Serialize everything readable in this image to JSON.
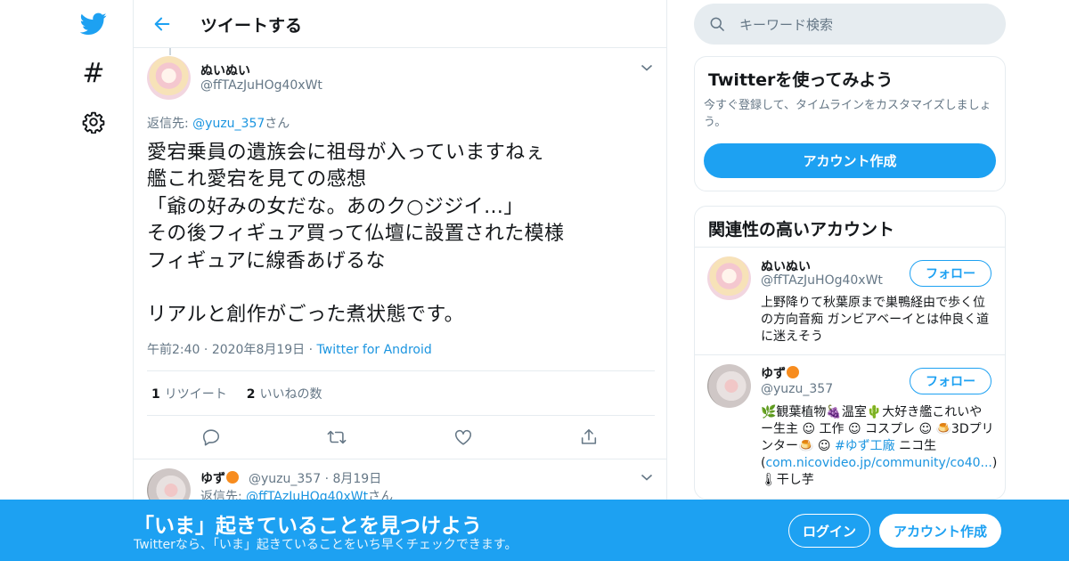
{
  "colors": {
    "accent": "#1da1f2",
    "link": "#1b95e0",
    "muted": "#657786",
    "border": "#e6ecf0"
  },
  "nav": {
    "items": [
      {
        "icon": "twitter-bird-icon"
      },
      {
        "icon": "hashtag-icon",
        "glyph": "#"
      },
      {
        "icon": "gear-icon"
      }
    ]
  },
  "header": {
    "title": "ツイートする",
    "back_icon": "back-arrow-icon"
  },
  "tweet": {
    "name": "ぬいぬい",
    "handle": "@ffTAzJuHOg40xWt",
    "reply_prefix": "返信先: ",
    "reply_to": "@yuzu_357",
    "reply_suffix": "さん",
    "body": "愛宕乗員の遺族会に祖母が入っていますねぇ\n艦これ愛宕を見ての感想\n「爺の好みの女だな。あのク○ジジイ…」\nその後フィギュア買って仏壇に設置された模様\nフィギュアに線香あげるな\n\nリアルと創作がごった煮状態です。",
    "time": "午前2:40",
    "date": "2020年8月19日",
    "dot": "·",
    "source": "Twitter for Android",
    "retweets_count": "1",
    "retweets_label": "リツイート",
    "likes_count": "2",
    "likes_label": "いいねの数"
  },
  "reply": {
    "name": "ゆず",
    "handle": "@yuzu_357",
    "dot": "·",
    "date": "8月19日",
    "reply_prefix": "返信先: ",
    "reply_to": "@ffTAzJuHOg40xWt",
    "reply_suffix": "さん"
  },
  "search": {
    "placeholder": "キーワード検索"
  },
  "signup_card": {
    "title": "Twitterを使ってみよう",
    "description": "今すぐ登録して、タイムラインをカスタマイズしましょう。",
    "button": "アカウント作成"
  },
  "related": {
    "title": "関連性の高いアカウント",
    "accounts": [
      {
        "name": "ぬいぬい",
        "handle": "@ffTAzJuHOg40xWt",
        "follow": "フォロー",
        "bio": "上野降りて秋葉原まで巣鴨経由で歩く位の方向音痴 ガンビアベーイとは仲良く道に迷えそう"
      },
      {
        "name": "ゆず",
        "handle": "@yuzu_357",
        "follow": "フォロー",
        "bio_1": "🌿観葉植物🍇温室🌵大好き艦これいやー生主 ☺ 工作 ☺ コスプレ ☺ 🍮3Dプリンター🍮 ☺ ",
        "bio_hashtag": "#ゆず工廠",
        "bio_2": " ニコ生(",
        "bio_link": "com.nicovideo.jp/community/co40...",
        "bio_3": ") 🌡干し芋"
      }
    ]
  },
  "bottom_bar": {
    "title": "「いま」起きていることを見つけよう",
    "subtitle": "Twitterなら、「いま」起きていることをいち早くチェックできます。",
    "login": "ログイン",
    "signup": "アカウント作成"
  }
}
